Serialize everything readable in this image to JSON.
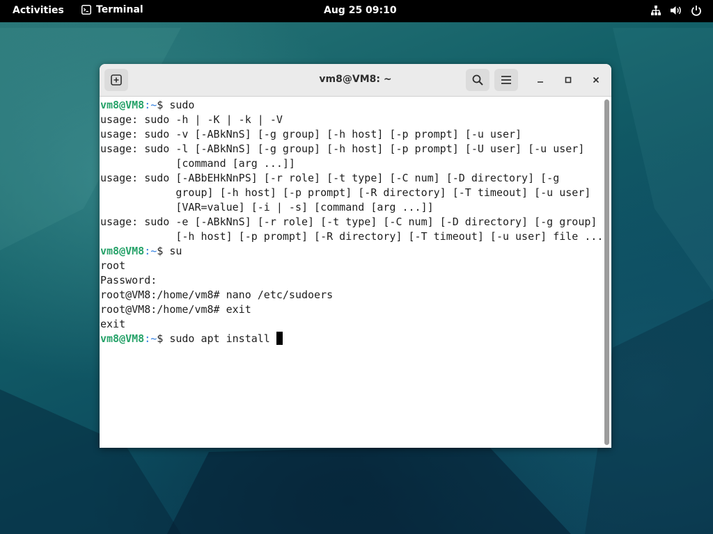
{
  "topbar": {
    "activities_label": "Activities",
    "app_name": "Terminal",
    "clock": "Aug 25  09:10",
    "icons": [
      "network-icon",
      "volume-icon",
      "power-icon"
    ]
  },
  "window": {
    "title": "vm8@VM8: ~",
    "header_icons": [
      "new-tab-icon",
      "search-icon",
      "hamburger-menu-icon",
      "minimize-icon",
      "maximize-icon",
      "close-icon"
    ]
  },
  "terminal": {
    "colors": {
      "prompt_user": "#26a269",
      "prompt_path": "#2a7bde",
      "text": "#1e1e1e",
      "background": "#ffffff"
    },
    "lines": [
      {
        "user": "vm8@VM8",
        "path": ":~",
        "text": "$ sudo"
      },
      {
        "text": "usage: sudo -h | -K | -k | -V"
      },
      {
        "text": "usage: sudo -v [-ABkNnS] [-g group] [-h host] [-p prompt] [-u user]"
      },
      {
        "text": "usage: sudo -l [-ABkNnS] [-g group] [-h host] [-p prompt] [-U user] [-u user]"
      },
      {
        "text": "            [command [arg ...]]"
      },
      {
        "text": "usage: sudo [-ABbEHkNnPS] [-r role] [-t type] [-C num] [-D directory] [-g"
      },
      {
        "text": "            group] [-h host] [-p prompt] [-R directory] [-T timeout] [-u user]"
      },
      {
        "text": "            [VAR=value] [-i | -s] [command [arg ...]]"
      },
      {
        "text": "usage: sudo -e [-ABkNnS] [-r role] [-t type] [-C num] [-D directory] [-g group]"
      },
      {
        "text": "            [-h host] [-p prompt] [-R directory] [-T timeout] [-u user] file ..."
      },
      {
        "user": "vm8@VM8",
        "path": ":~",
        "text": "$ su"
      },
      {
        "text": "root"
      },
      {
        "text": "Password:"
      },
      {
        "text": "root@VM8:/home/vm8# nano /etc/sudoers"
      },
      {
        "text": "root@VM8:/home/vm8# exit"
      },
      {
        "text": "exit"
      },
      {
        "user": "vm8@VM8",
        "path": ":~",
        "text": "$ sudo apt install ",
        "cursor": true
      }
    ]
  }
}
